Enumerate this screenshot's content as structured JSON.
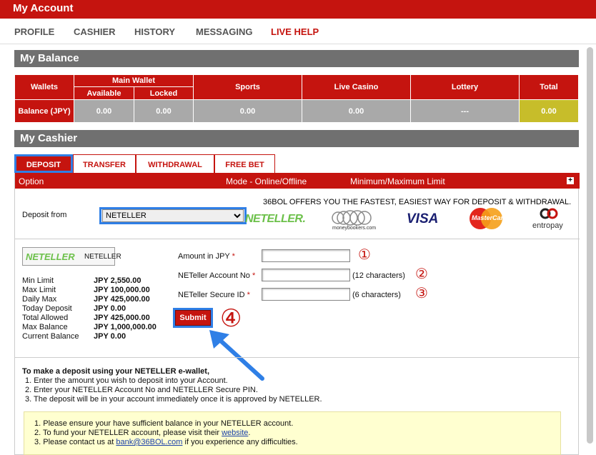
{
  "header": {
    "title": "My Account"
  },
  "nav": {
    "items": [
      "PROFILE",
      "CASHIER",
      "HISTORY",
      "MESSAGING",
      "LIVE HELP"
    ]
  },
  "balance": {
    "title": "My Balance",
    "headers": {
      "wallets": "Wallets",
      "main_wallet": "Main Wallet",
      "available": "Available",
      "locked": "Locked",
      "sports": "Sports",
      "live_casino": "Live Casino",
      "lottery": "Lottery",
      "total": "Total"
    },
    "row_label": "Balance (JPY)",
    "values": {
      "available": "0.00",
      "locked": "0.00",
      "sports": "0.00",
      "live_casino": "0.00",
      "lottery": "---",
      "total": "0.00"
    }
  },
  "cashier": {
    "title": "My Cashier",
    "tabs": [
      "DEPOSIT",
      "TRANSFER",
      "WITHDRAWAL",
      "FREE BET"
    ],
    "panel_head": {
      "option": "Option",
      "mode": "Mode - Online/Offline",
      "limit": "Minimum/Maximum Limit",
      "expand": "+"
    },
    "offer": "36BOL OFFERS YOU THE FASTEST, EASIEST WAY FOR DEPOSIT & WITHDRAWAL.",
    "deposit_from_label": "Deposit from",
    "deposit_from_value": "NETELLER",
    "logos": {
      "neteller": "NETELLER.",
      "moneybookers": "moneybookers.com",
      "visa": "VISA",
      "mastercard": "MasterCard",
      "entropay": "entropay"
    },
    "netbox": {
      "logo": "NETELLER",
      "label": "NETELLER"
    },
    "limits": [
      {
        "label": "Min Limit",
        "value": "JPY 2,550.00"
      },
      {
        "label": "Max Limit",
        "value": "JPY 100,000.00"
      },
      {
        "label": "Daily Max",
        "value": "JPY 425,000.00"
      },
      {
        "label": "Today Deposit",
        "value": "JPY 0.00"
      },
      {
        "label": "Total Allowed",
        "value": "JPY 425,000.00"
      },
      {
        "label": "Max Balance",
        "value": "JPY 1,000,000.00"
      },
      {
        "label": "Current Balance",
        "value": "JPY 0.00"
      }
    ],
    "fields": {
      "amount": {
        "label": "Amount in JPY",
        "value": "",
        "hint": ""
      },
      "account": {
        "label": "NETeller Account No",
        "value": "",
        "hint": "(12 characters)"
      },
      "secure": {
        "label": "NETeller Secure ID",
        "value": "",
        "hint": "(6 characters)"
      },
      "required_mark": "*"
    },
    "submit_label": "Submit",
    "markers": [
      "①",
      "②",
      "③",
      "④"
    ],
    "instructions": {
      "title": "To make a deposit using your NETELLER e-wallet,",
      "steps": [
        "1.  Enter the amount you wish to deposit into your Account.",
        "2.  Enter your NETELLER Account No and NETELLER Secure PIN.",
        "3.  The deposit will be in your account immediately once it is approved by NETELLER."
      ]
    },
    "notice": {
      "line1": "1.  Please ensure your have sufficient balance in your NETELLER account.",
      "line2_pre": "2.  To fund your NETELLER account, please visit their ",
      "line2_link": "website",
      "line2_post": ".",
      "line3_pre": "3.  Please contact us at ",
      "line3_link": "bank@36BOL.com",
      "line3_post": " if you experience any difficulties."
    }
  },
  "colors": {
    "brand_red": "#c5140f",
    "highlight_blue": "#2f7fe6",
    "bar_grey": "#707070",
    "total_yellow": "#c7bd2a"
  }
}
